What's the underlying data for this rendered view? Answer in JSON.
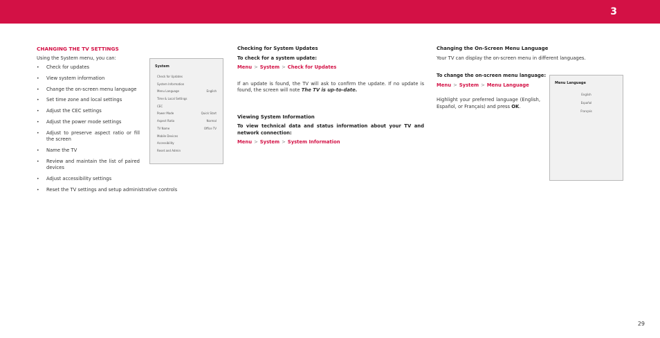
{
  "header": {
    "chapter_number": "3"
  },
  "page_number": "29",
  "col1": {
    "title": "CHANGING THE TV SETTINGS",
    "intro": "Using the System menu, you can:",
    "bullets": [
      "Check for updates",
      "View system information",
      "Change the on-screen menu language",
      "Set time zone and local settings",
      "Adjust the CEC settings",
      "Adjust the power mode settings",
      "Adjust to preserve aspect ratio or fill the screen",
      "Name the TV",
      "Review and maintain the list of paired devices",
      "Adjust accessibility settings",
      "Reset the TV settings and setup administrative controls"
    ]
  },
  "system_menu": {
    "title": "System",
    "items": [
      {
        "label": "Check for Updates",
        "value": ""
      },
      {
        "label": "System Information",
        "value": ""
      },
      {
        "label": "Menu Language",
        "value": "English"
      },
      {
        "label": "Time & Local Settings",
        "value": ""
      },
      {
        "label": "CEC",
        "value": ""
      },
      {
        "label": "Power Mode",
        "value": "Quick Start"
      },
      {
        "label": "Aspect Ratio",
        "value": "Normal"
      },
      {
        "label": "TV Name",
        "value": "Office TV"
      },
      {
        "label": "Mobile Devices",
        "value": ""
      },
      {
        "label": "Accessibility",
        "value": ""
      },
      {
        "label": "Reset and Admin",
        "value": ""
      }
    ]
  },
  "col2": {
    "updates_title": "Checking for System Updates",
    "updates_instr": "To check for a system update:",
    "updates_path": [
      "Menu",
      "System",
      "Check for Updates"
    ],
    "path_sep": ">",
    "updates_body_pre": "If an update is found, the TV will ask to confirm the update. If no update is found, the screen will note ",
    "updates_body_em": "The TV is up-to-date.",
    "info_title": "Viewing System Information",
    "info_instr": "To view technical data and status information about your TV and network connection:",
    "info_path": [
      "Menu",
      "System",
      "System Information"
    ]
  },
  "col3": {
    "title": "Changing the On-Screen Menu Language",
    "intro": "Your TV can display the on-screen menu in different languages.",
    "instr": "To change the on-screen menu language:",
    "path": [
      "Menu",
      "System",
      "Menu Language"
    ],
    "body_pre": "Highlight your preferred language (English, Español, or Français) and press ",
    "body_ok": "OK",
    "body_post": "."
  },
  "language_menu": {
    "title": "Menu Language",
    "options": [
      "English",
      "Español",
      "Français"
    ]
  },
  "colors": {
    "accent": "#d31145"
  }
}
